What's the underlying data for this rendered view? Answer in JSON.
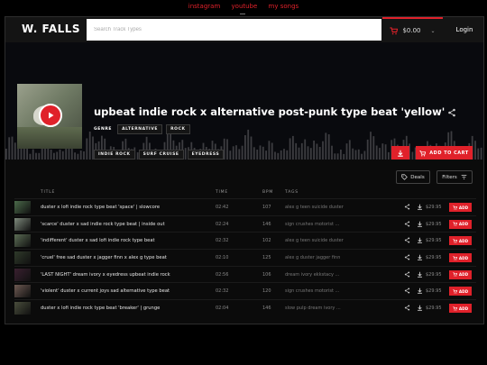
{
  "top_links": [
    "instagram",
    "youtube",
    "my songs"
  ],
  "header": {
    "brand": "W. FALLS",
    "search_placeholder": "Search Track Types",
    "cart_total": "$0.00",
    "login": "Login"
  },
  "featured": {
    "title": "upbeat indie rock x alternative post-punk type beat 'yellow'",
    "genre_label": "GENRE",
    "genres": [
      "ALTERNATIVE",
      "ROCK"
    ],
    "tags": [
      "INDIE ROCK",
      "SURF CRUISE",
      "EYEDRESS"
    ],
    "add_to_cart": "ADD TO CART"
  },
  "filters": {
    "deals": "Deals",
    "filters": "Filters"
  },
  "table": {
    "headers": {
      "title": "TITLE",
      "time": "TIME",
      "bpm": "BPM",
      "tags": "TAGS"
    },
    "add_label": "ADD",
    "rows": [
      {
        "title": "duster x lofi indie rock type beat 'space' | slowcore",
        "time": "02:42",
        "bpm": "107",
        "tags": "alex g  teen suicide  duster",
        "price": "$29.95",
        "thumb": "#4b6a4a"
      },
      {
        "title": "'scarce' duster x sad indie rock type beat | inside out",
        "time": "02:24",
        "bpm": "146",
        "tags": "sign crushes motorist ...",
        "price": "$29.95",
        "thumb": "#7e8a7c"
      },
      {
        "title": "'indifferent' duster x sad lofi indie rock type beat",
        "time": "02:32",
        "bpm": "102",
        "tags": "alex g  teen suicide  duster",
        "price": "$29.95",
        "thumb": "#5c6d55"
      },
      {
        "title": "'cruel' free sad duster x jagger finn x alex g type beat",
        "time": "02:10",
        "bpm": "125",
        "tags": "alex g  duster  jagger finn",
        "price": "$29.95",
        "thumb": "#2f3a2a"
      },
      {
        "title": "'LAST NIGHT' dream ivory x eyedress upbeat indie rock",
        "time": "02:56",
        "bpm": "106",
        "tags": "dream ivory  ekkstacy ...",
        "price": "$29.95",
        "thumb": "#3a2030"
      },
      {
        "title": "'violent' duster x current joys sad alternative type beat",
        "time": "02:32",
        "bpm": "120",
        "tags": "sign crushes motorist ...",
        "price": "$29.95",
        "thumb": "#6e5a52"
      },
      {
        "title": "duster x lofi indie rock type beat 'breaker' | grunge",
        "time": "02:04",
        "bpm": "146",
        "tags": "slow pulp  dream ivory ...",
        "price": "$29.95",
        "thumb": "#4a4e3c"
      }
    ]
  },
  "colors": {
    "accent": "#e0212a",
    "background": "#000000"
  }
}
